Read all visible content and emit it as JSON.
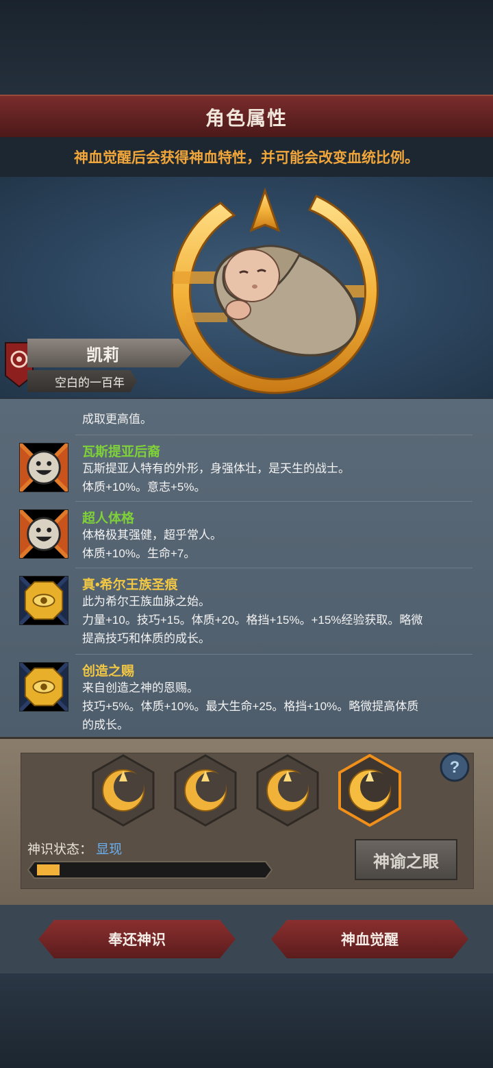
{
  "header": {
    "title": "角色属性",
    "subtitle": "神血觉醒后会获得神血特性，并可能会改变血统比例。"
  },
  "character": {
    "name": "凯莉",
    "title": "空白的一百年"
  },
  "traits_partial_text": "成取更高值。",
  "traits": [
    {
      "name": "瓦斯提亚后裔",
      "icon": "smiley-face-icon",
      "color": "#7fd13a",
      "desc": [
        "瓦斯提亚人特有的外形，身强体壮，是天生的战士。",
        "体质+10%。意志+5%。"
      ]
    },
    {
      "name": "超人体格",
      "icon": "smiley-face-icon",
      "color": "#7fd13a",
      "desc": [
        "体格极其强健，超乎常人。",
        "体质+10%。生命+7。"
      ]
    },
    {
      "name": "真•希尔王族圣痕",
      "icon": "golden-eye-seal-icon",
      "color": "#f2c744",
      "desc": [
        "此为希尔王族血脉之始。",
        "力量+10。技巧+15。体质+20。格挡+15%。+15%经验获取。略微",
        "提高技巧和体质的成长。"
      ]
    },
    {
      "name": "创造之赐",
      "icon": "golden-eye-seal-icon",
      "color": "#f2c744",
      "desc": [
        "来自创造之神的恩赐。",
        "技巧+5%。体质+10%。最大生命+25。格挡+10%。略微提高体质",
        "的成长。"
      ]
    }
  ],
  "divine": {
    "status_label": "神识状态：",
    "status_value": "显现",
    "progress": 0.1,
    "oracle_button": "神谕之眼",
    "runes": [
      "divine-rune-icon",
      "divine-rune-icon",
      "divine-rune-icon",
      "divine-rune-icon"
    ],
    "selected_rune": 3
  },
  "buttons": {
    "return": "奉还神识",
    "awaken": "神血觉醒"
  },
  "colors": {
    "accent_orange": "#f0a63a",
    "trait_green": "#7fd13a",
    "trait_yellow": "#f2c744",
    "status_blue": "#6ab0f0"
  }
}
